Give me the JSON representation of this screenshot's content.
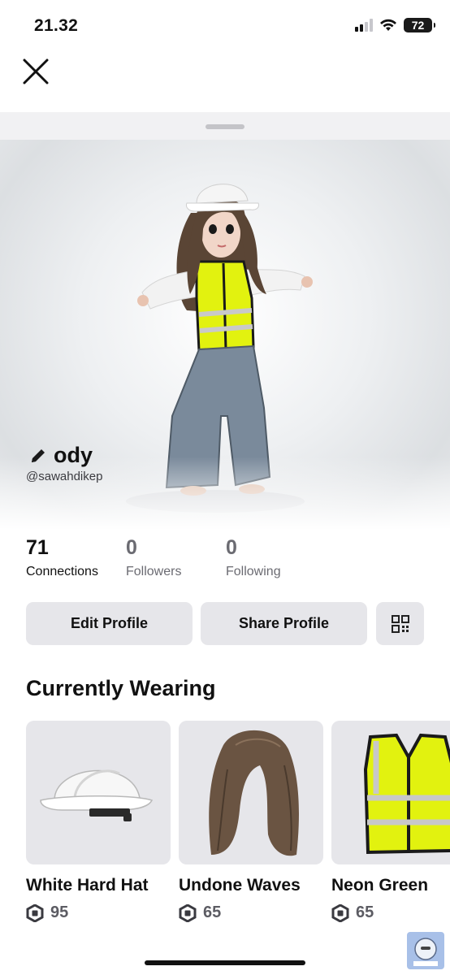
{
  "status_bar": {
    "time": "21.32",
    "battery": "72"
  },
  "profile": {
    "display_name": "ody",
    "username": "@sawahdikep",
    "stats": [
      {
        "value": "71",
        "label": "Connections"
      },
      {
        "value": "0",
        "label": "Followers"
      },
      {
        "value": "0",
        "label": "Following"
      }
    ]
  },
  "actions": {
    "edit_label": "Edit Profile",
    "share_label": "Share Profile"
  },
  "section": {
    "title": "Currently Wearing"
  },
  "items": [
    {
      "name": "White Hard Hat",
      "price": "95",
      "icon": "hard-hat"
    },
    {
      "name": "Undone Waves",
      "price": "65",
      "icon": "hair"
    },
    {
      "name": "Neon Green",
      "price": "65",
      "icon": "safety-vest"
    }
  ],
  "colors": {
    "vest": "#e2f20f",
    "button_bg": "#e6e6ea",
    "muted_text": "#6b6b72"
  }
}
